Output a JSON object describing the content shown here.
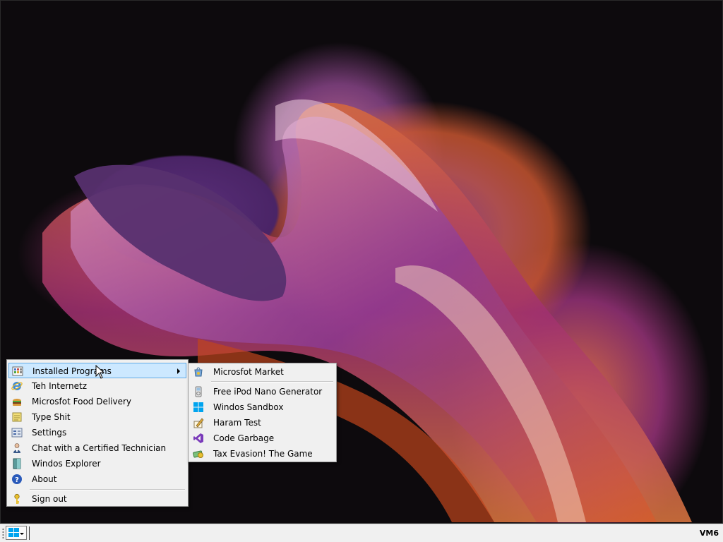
{
  "start_menu": {
    "items": [
      {
        "label": "Installed Programs",
        "icon": "installed-programs-icon",
        "has_submenu": true,
        "active": true
      },
      {
        "label": "Teh Internetz",
        "icon": "internet-explorer-icon"
      },
      {
        "label": "Microsfot Food Delivery",
        "icon": "burger-icon"
      },
      {
        "label": "Type Shit",
        "icon": "notepad-icon"
      },
      {
        "label": "Settings",
        "icon": "settings-icon"
      },
      {
        "label": "Chat with a Certified Technician",
        "icon": "technician-icon"
      },
      {
        "label": "Windos Explorer",
        "icon": "explorer-icon"
      },
      {
        "label": "About",
        "icon": "help-icon"
      },
      {
        "label": "Sign out",
        "icon": "key-icon"
      }
    ]
  },
  "submenu": {
    "items": [
      {
        "label": "Microsfot Market",
        "icon": "market-icon"
      },
      {
        "label": "Free iPod Nano Generator",
        "icon": "ipod-icon"
      },
      {
        "label": "Windos Sandbox",
        "icon": "windows-logo-icon"
      },
      {
        "label": "Haram Test",
        "icon": "pen-paper-icon"
      },
      {
        "label": "Code Garbage",
        "icon": "visual-studio-icon"
      },
      {
        "label": "Tax Evasion! The Game",
        "icon": "money-icon"
      }
    ]
  },
  "taskbar": {
    "start_icon": "windows-logo-icon",
    "machine_label": "VM6"
  },
  "colors": {
    "menu_bg": "#f0f0f0",
    "highlight_bg": "#cce8ff",
    "highlight_border": "#5fa9e5",
    "windows_blue": "#00a4ef"
  }
}
